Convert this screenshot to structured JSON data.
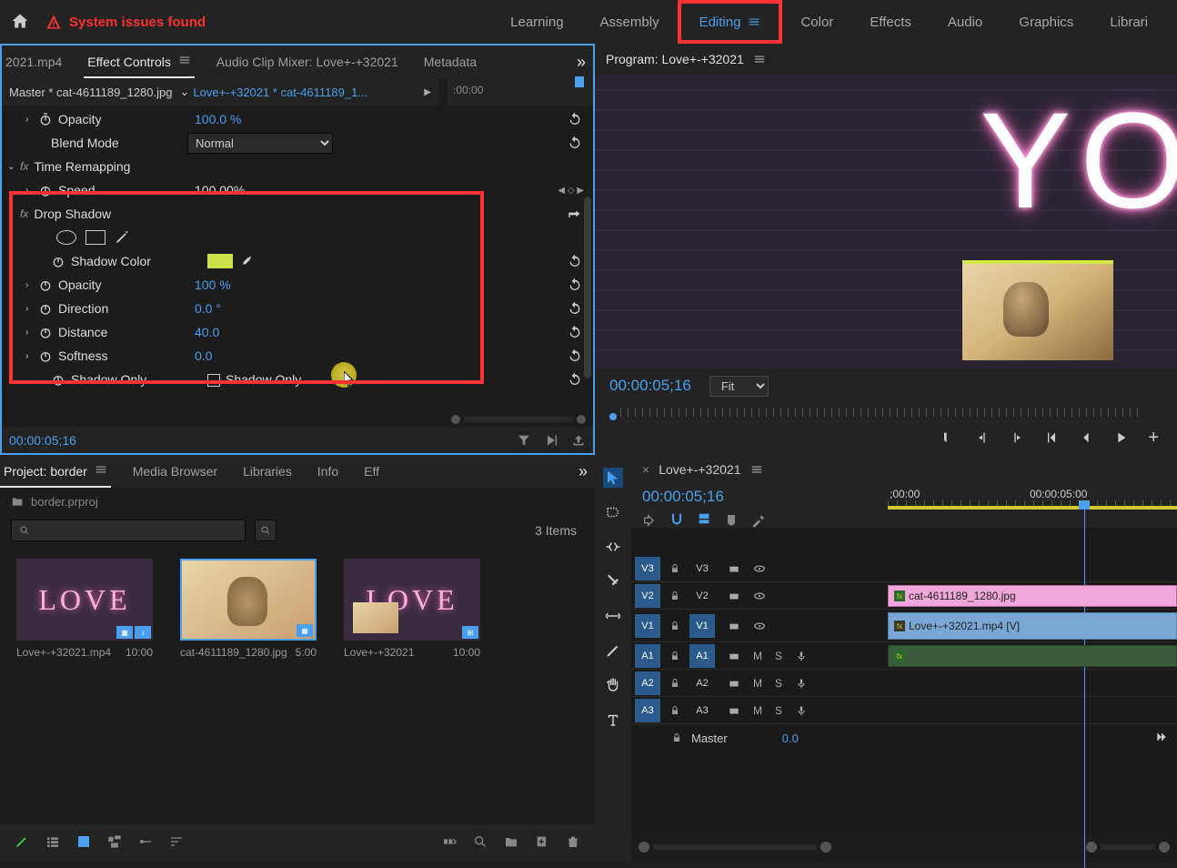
{
  "system_warning": "System issues found",
  "workspaces": [
    "Learning",
    "Assembly",
    "Editing",
    "Color",
    "Effects",
    "Audio",
    "Graphics",
    "Librari"
  ],
  "active_workspace": "Editing",
  "source_tabs": {
    "t0": "2021.mp4",
    "active": "Effect Controls",
    "t2": "Audio Clip Mixer: Love+-+32021",
    "t3": "Metadata"
  },
  "master_clip": "Master * cat-4611189_1280.jpg",
  "sequence_clip": "Love+-+32021 * cat-4611189_1...",
  "ruler_t0": ":00:00",
  "effects": {
    "opacity_label": "Opacity",
    "opacity_val": "100.0 %",
    "blend_label": "Blend Mode",
    "blend_val": "Normal",
    "time_remap": "Time Remapping",
    "speed_label": "Speed",
    "speed_val": "100.00%",
    "drop_shadow": "Drop Shadow",
    "shadow_color_label": "Shadow Color",
    "shadow_color_val": "#cde24a",
    "ds_opacity_label": "Opacity",
    "ds_opacity_val": "100 %",
    "direction_label": "Direction",
    "direction_val": "0.0 °",
    "distance_label": "Distance",
    "distance_val": "40.0",
    "softness_label": "Softness",
    "softness_val": "0.0",
    "shadow_only_label": "Shadow Only",
    "shadow_only_check": "Shadow Only"
  },
  "source_tc": "00:00:05;16",
  "program": {
    "title": "Program: Love+-+32021",
    "tc": "00:00:05;16",
    "zoom": "Fit",
    "neon": "YO"
  },
  "project": {
    "tabs": {
      "active": "Project: border",
      "t1": "Media Browser",
      "t2": "Libraries",
      "t3": "Info",
      "t4": "Eff"
    },
    "file": "border.prproj",
    "item_count": "3 Items",
    "items": [
      {
        "name": "Love+-+32021.mp4",
        "dur": "10:00",
        "neon": "LOVE"
      },
      {
        "name": "cat-4611189_1280.jpg",
        "dur": "5:00"
      },
      {
        "name": "Love+-+32021",
        "dur": "10:00",
        "neon": "LOVE"
      }
    ]
  },
  "timeline": {
    "seq_name": "Love+-+32021",
    "tc": "00:00:05;16",
    "t0": ";00:00",
    "t1": "00:00:05:00",
    "tracks_v": [
      "V3",
      "V2",
      "V1"
    ],
    "tracks_a": [
      "A1",
      "A2",
      "A3"
    ],
    "clip_v2": "cat-4611189_1280.jpg",
    "clip_v1": "Love+-+32021.mp4 [V]",
    "master_label": "Master",
    "master_val": "0.0"
  }
}
